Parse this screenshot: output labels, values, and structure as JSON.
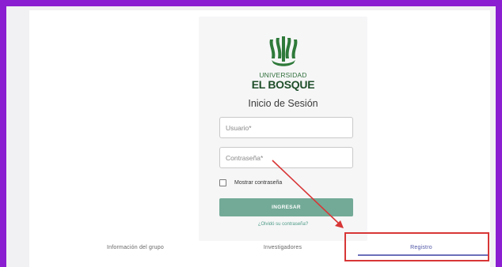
{
  "branding": {
    "university_small": "UNIVERSIDAD",
    "university_name": "EL BOSQUE"
  },
  "login": {
    "title": "Inicio de Sesión",
    "username_placeholder": "Usuario*",
    "password_placeholder": "Contraseña*",
    "show_password_label": "Mostrar contraseña",
    "submit_label": "INGRESAR",
    "forgot_link": "¿Olvidó su contraseña?"
  },
  "tabs": [
    {
      "label": "Información del grupo"
    },
    {
      "label": "Investigadores"
    },
    {
      "label": "Registro",
      "active": true
    }
  ],
  "colors": {
    "outer_border": "#8a1ed0",
    "primary_button": "#73aa97",
    "logo_green": "#1f4f2a",
    "active_tab": "#4f55a5",
    "annotation_red": "#d83636"
  },
  "icons": {
    "logo": "university-el-bosque-logo-icon"
  }
}
